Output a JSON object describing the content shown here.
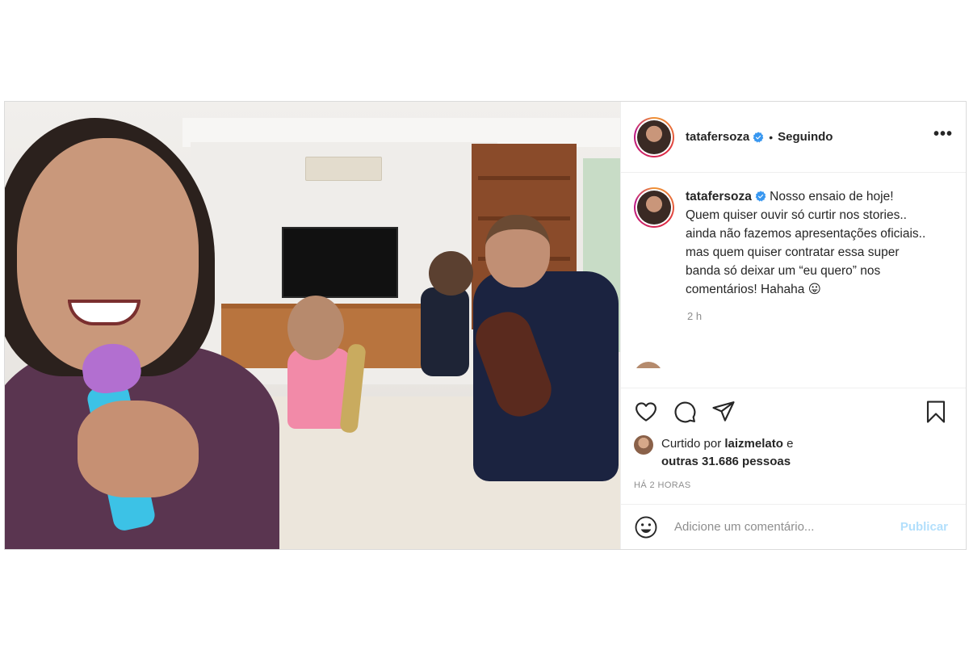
{
  "post": {
    "header": {
      "username": "tatafersoza",
      "separator": "•",
      "follow_status": "Seguindo",
      "more_label": "•••"
    },
    "caption": {
      "username": "tatafersoza",
      "text": "Nosso ensaio de hoje! Quem quiser ouvir só curtir nos stories.. ainda não fazemos apresentações oficiais.. mas quem quiser contratar essa super banda só deixar um “eu quero” nos comentários! Hahaha 😛",
      "time": "2 h"
    },
    "likes": {
      "prefix": "Curtido por",
      "liker": "laizmelato",
      "conjunction": "e",
      "others": "outras 31.686 pessoas"
    },
    "posted_ago": "HÁ 2 HORAS",
    "comment_box": {
      "placeholder": "Adicione um comentário...",
      "publish_label": "Publicar"
    },
    "icons": {
      "like": "heart-icon",
      "comment": "comment-icon",
      "share": "share-icon",
      "save": "bookmark-icon",
      "emoji": "emoji-icon",
      "more": "more-options-icon",
      "verified": "verified-badge-icon"
    },
    "colors": {
      "verified_blue": "#3897f0",
      "publish_disabled": "#b2dffc",
      "muted_text": "#8e8e8e"
    }
  }
}
